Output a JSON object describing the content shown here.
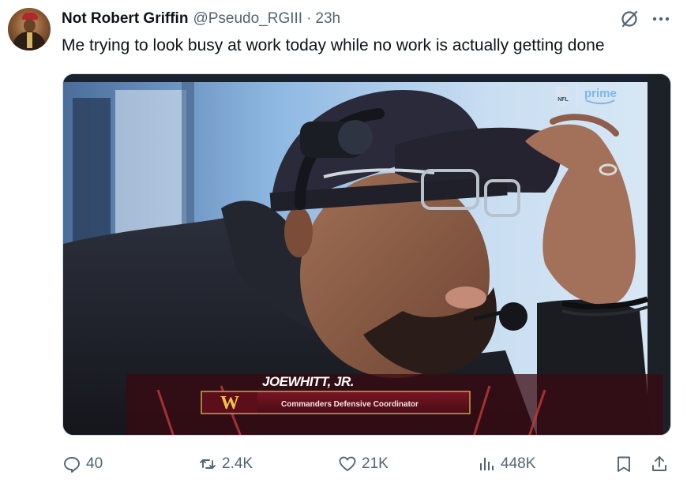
{
  "author": {
    "display_name": "Not Robert Griffin",
    "handle": "@Pseudo_RGIII",
    "separator": "·",
    "time": "23h"
  },
  "tweet": {
    "text": "Me trying to look busy at work today while no work is actually getting done"
  },
  "media": {
    "broadcast_logo": "prime",
    "nfl_badge": "NFL",
    "lower_third": {
      "name": "JOEWHITT, JR.",
      "title": "Commanders Defensive Coordinator",
      "team_logo": "W"
    }
  },
  "stats": {
    "replies": "40",
    "reposts": "2.4K",
    "likes": "21K",
    "views": "448K"
  },
  "icons": {
    "reply": "reply-icon",
    "repost": "repost-icon",
    "like": "heart-icon",
    "views": "views-icon",
    "bookmark": "bookmark-icon",
    "share": "share-icon",
    "grok": "grok-icon",
    "more": "more-icon"
  },
  "colors": {
    "text_primary": "#0f1419",
    "text_secondary": "#536471",
    "prime_blue": "#7fb6e8",
    "commanders_burgundy": "#6e1220",
    "commanders_gold": "#f2c34a"
  }
}
